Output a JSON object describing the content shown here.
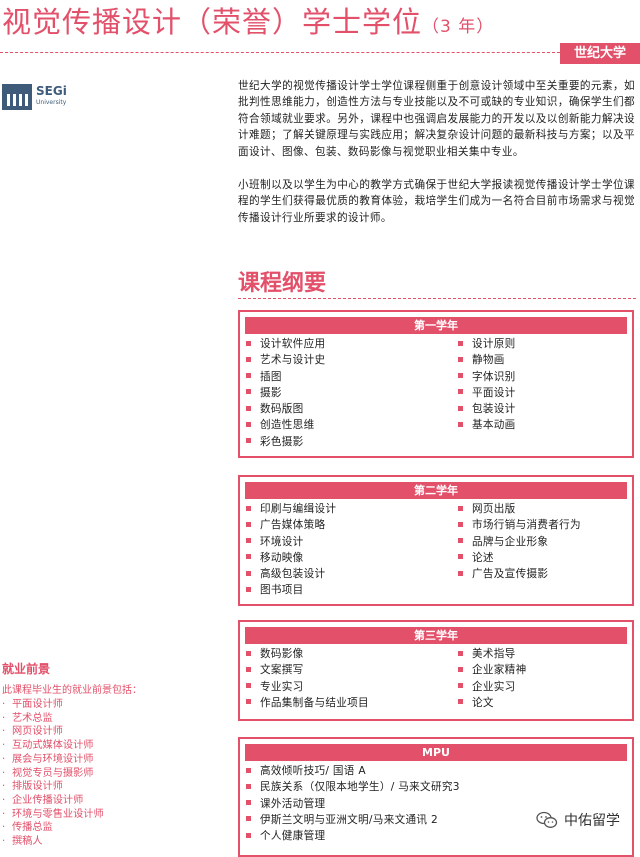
{
  "header": {
    "title": "视觉传播设计（荣誉）学士学位",
    "duration": "（3 年）",
    "university_badge": "世纪大学"
  },
  "logo": {
    "name": "SEGi",
    "subtitle": "University"
  },
  "intro": {
    "paragraphs": [
      "世纪大学的视觉传播设计学士学位课程侧重于创意设计领域中至关重要的元素，如批判性思维能力，创造性方法与专业技能以及不可或缺的专业知识，确保学生们都符合领域就业要求。另外，课程中也强调启发展能力的开发以及以创新能力解决设计难题；了解关键原理与实践应用；解决复杂设计问题的最新科技与方案；以及平面设计、图像、包装、数码影像与视觉职业相关集中专业。",
      "小班制以及以学生为中心的教学方式确保于世纪大学报读视觉传播设计学士学位课程的学生们获得最优质的教育体验，栽培学生们成为一名符合目前市场需求与视觉传播设计行业所要求的设计师。"
    ]
  },
  "outline": {
    "title": "课程纲要",
    "years": [
      {
        "heading": "第一学年",
        "left": [
          "设计软件应用",
          "艺术与设计史",
          "插图",
          "摄影",
          "数码版图",
          "创造性思维",
          "彩色摄影"
        ],
        "right": [
          "设计原则",
          "静物画",
          "字体识别",
          "平面设计",
          "包装设计",
          "基本动画"
        ]
      },
      {
        "heading": "第二学年",
        "left": [
          "印刷与编缉设计",
          "广告媒体策略",
          "环境设计",
          "移动映像",
          "高级包装设计",
          "图书项目"
        ],
        "right": [
          "网页出版",
          "市场行销与消费者行为",
          "品牌与企业形象",
          "论述",
          "广告及宣传摄影"
        ]
      },
      {
        "heading": "第三学年",
        "left": [
          "数码影像",
          "文案撰写",
          "专业实习",
          "作品集制备与结业项目"
        ],
        "right": [
          "美术指导",
          "企业家精神",
          "企业实习",
          "论文"
        ]
      },
      {
        "heading": "MPU",
        "left": [
          "高效倾听技巧/ 国语 A",
          "民族关系（仅限本地学生）/ 马来文研究3",
          "课外活动管理",
          "伊斯兰文明与亚洲文明/马来文通讯 2",
          "个人健康管理"
        ],
        "right": []
      }
    ]
  },
  "career": {
    "title": "就业前景",
    "intro": "此课程毕业生的就业前景包括：",
    "items": [
      "平面设计师",
      "艺术总监",
      "网页设计师",
      "互动式媒体设计师",
      "展会与环境设计师",
      "视觉专员与摄影师",
      "排版设计师",
      "企业传播设计师",
      "环境与零售业设计师",
      "传播总监",
      "撰稿人"
    ]
  },
  "watermark": {
    "text": "中佑留学"
  },
  "colors": {
    "accent": "#e2506a"
  }
}
